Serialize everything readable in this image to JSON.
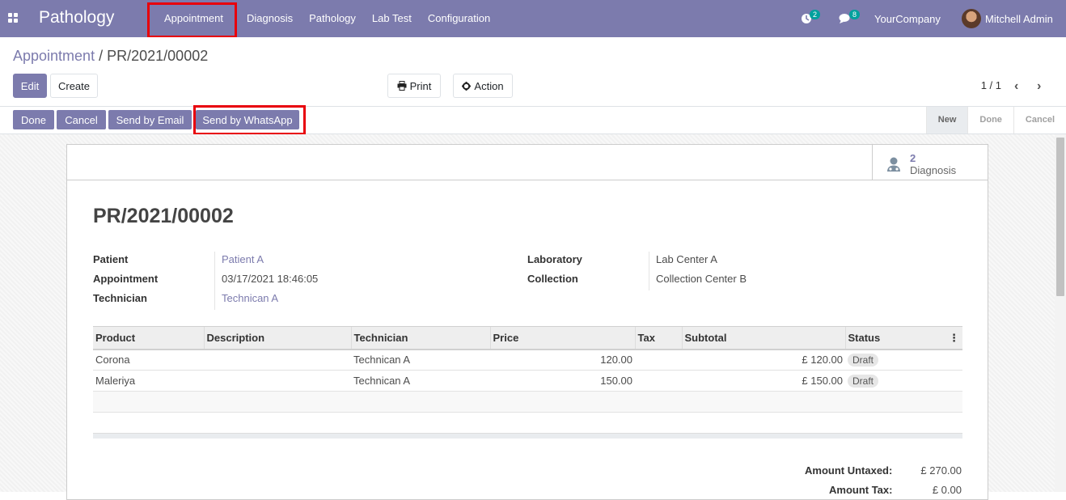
{
  "brand": "Pathology",
  "menu": [
    "Appointment",
    "Diagnosis",
    "Pathology",
    "Lab Test",
    "Configuration"
  ],
  "activities_count": "2",
  "messages_count": "8",
  "company": "YourCompany",
  "user": "Mitchell Admin",
  "breadcrumb": {
    "parent": "Appointment",
    "sep": "/",
    "current": "PR/2021/00002"
  },
  "buttons": {
    "edit": "Edit",
    "create": "Create",
    "print": "Print",
    "action": "Action"
  },
  "pager": "1 / 1",
  "status_buttons": [
    "Done",
    "Cancel",
    "Send by Email",
    "Send by WhatsApp"
  ],
  "stages": [
    "New",
    "Done",
    "Cancel"
  ],
  "smart_button": {
    "count": "2",
    "label": "Diagnosis"
  },
  "record": {
    "name": "PR/2021/00002",
    "patient_label": "Patient",
    "patient": "Patient A",
    "appointment_label": "Appointment",
    "appointment": "03/17/2021 18:46:05",
    "technician_label": "Technician",
    "technician": "Technican A",
    "laboratory_label": "Laboratory",
    "laboratory": "Lab Center A",
    "collection_label": "Collection",
    "collection": "Collection Center B"
  },
  "table": {
    "headers": [
      "Product",
      "Description",
      "Technician",
      "Price",
      "Tax",
      "Subtotal",
      "Status"
    ],
    "rows": [
      {
        "product": "Corona",
        "description": "",
        "technician": "Technican A",
        "price": "120.00",
        "tax": "",
        "subtotal": "£ 120.00",
        "status": "Draft"
      },
      {
        "product": "Maleriya",
        "description": "",
        "technician": "Technican A",
        "price": "150.00",
        "tax": "",
        "subtotal": "£ 150.00",
        "status": "Draft"
      }
    ]
  },
  "totals": {
    "untaxed_label": "Amount Untaxed:",
    "untaxed": "£ 270.00",
    "tax_label": "Amount Tax:",
    "tax": "£ 0.00"
  },
  "colors": {
    "brand": "#7c7bad",
    "highlight": "#e8000b",
    "badge": "#00a09d"
  }
}
